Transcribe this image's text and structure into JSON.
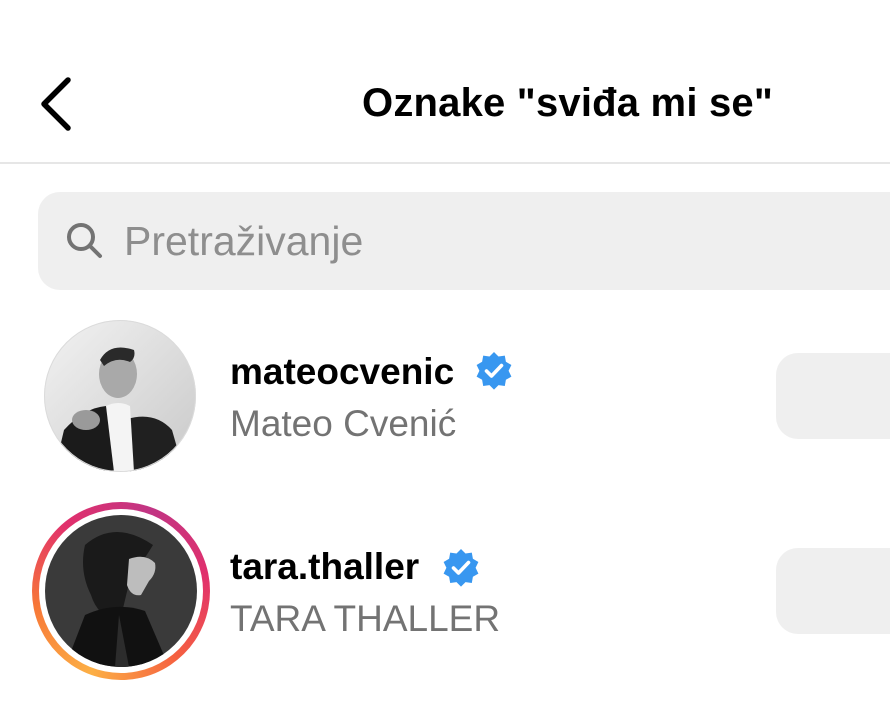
{
  "header": {
    "title": "Oznake \"sviđa mi se\"",
    "back_icon": "chevron-left-icon"
  },
  "search": {
    "placeholder": "Pretraživanje",
    "value": "",
    "icon": "search-icon"
  },
  "likes": [
    {
      "username": "mateocvenic",
      "full_name": "Mateo Cvenić",
      "verified": true,
      "has_story_ring": false,
      "button_label": ""
    },
    {
      "username": "tara.thaller",
      "full_name": "TARA THALLER",
      "verified": true,
      "has_story_ring": true,
      "button_label": ""
    }
  ],
  "colors": {
    "verified_blue": "#3897f0",
    "secondary_text": "#737373",
    "search_bg": "#efefef",
    "story_ring": [
      "#fcaf45",
      "#e1306c",
      "#c13584"
    ]
  }
}
